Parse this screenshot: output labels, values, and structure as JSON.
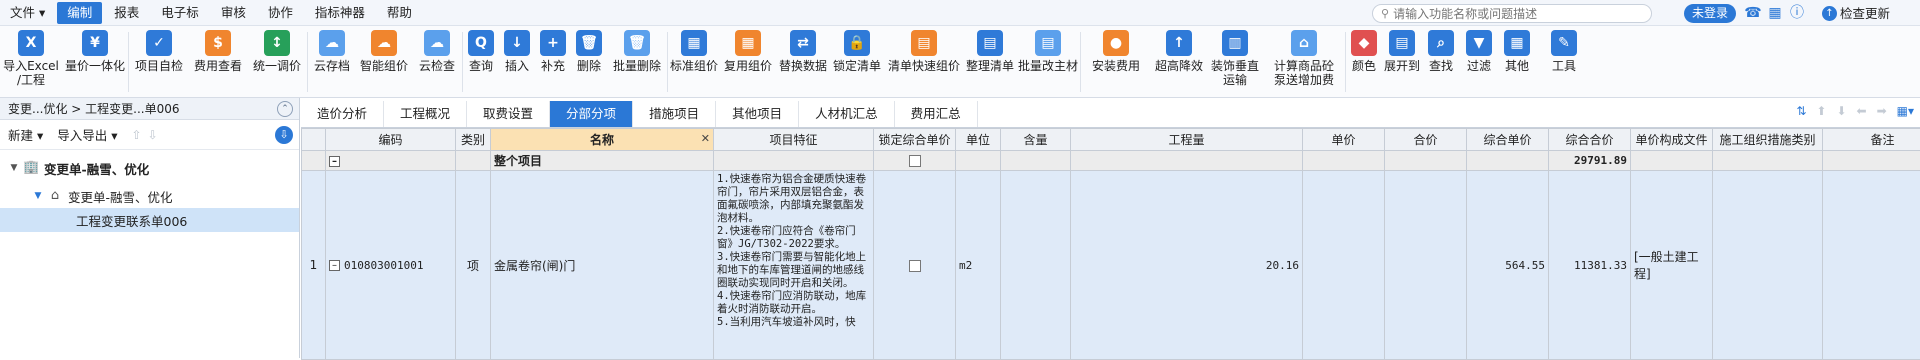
{
  "menu": {
    "file": "文件",
    "items": [
      "编制",
      "报表",
      "电子标",
      "审核",
      "协作",
      "指标神器",
      "帮助"
    ],
    "search_placeholder": "请输入功能名称或问题描述",
    "login": "未登录",
    "update": "检查更新"
  },
  "ribbon": [
    {
      "label": "导入Excel\n/工程",
      "icon": "excel-import-icon"
    },
    {
      "label": "量价一体化",
      "icon": "price-integration-icon"
    },
    {
      "label": "项目自检",
      "icon": "project-check-icon"
    },
    {
      "label": "费用查看",
      "icon": "cost-view-icon"
    },
    {
      "label": "统一调价",
      "icon": "adjust-price-icon"
    },
    {
      "label": "云存档",
      "icon": "cloud-archive-icon"
    },
    {
      "label": "智能组价",
      "icon": "smart-pricing-icon"
    },
    {
      "label": "云检查",
      "icon": "cloud-check-icon"
    },
    {
      "label": "查询",
      "icon": "query-icon"
    },
    {
      "label": "插入",
      "icon": "insert-icon"
    },
    {
      "label": "补充",
      "icon": "supplement-icon"
    },
    {
      "label": "删除",
      "icon": "delete-icon"
    },
    {
      "label": "批量删除",
      "icon": "batch-delete-icon"
    },
    {
      "label": "标准组价",
      "icon": "standard-pricing-icon"
    },
    {
      "label": "复用组价",
      "icon": "reuse-pricing-icon"
    },
    {
      "label": "替换数据",
      "icon": "replace-data-icon"
    },
    {
      "label": "锁定清单",
      "icon": "lock-list-icon"
    },
    {
      "label": "清单快速组价",
      "icon": "quick-pricing-icon"
    },
    {
      "label": "整理清单",
      "icon": "organize-list-icon"
    },
    {
      "label": "批量改主材",
      "icon": "batch-material-icon"
    },
    {
      "label": "安装费用",
      "icon": "install-cost-icon"
    },
    {
      "label": "超高降效",
      "icon": "high-efficiency-icon"
    },
    {
      "label": "装饰垂直\n运输",
      "icon": "vertical-transport-icon"
    },
    {
      "label": "计算商品砼\n泵送增加费",
      "icon": "concrete-pump-icon"
    },
    {
      "label": "颜色",
      "icon": "color-icon"
    },
    {
      "label": "展开到",
      "icon": "expand-to-icon"
    },
    {
      "label": "查找",
      "icon": "find-icon"
    },
    {
      "label": "过滤",
      "icon": "filter-icon"
    },
    {
      "label": "其他",
      "icon": "other-icon"
    },
    {
      "label": "工具",
      "icon": "tools-icon"
    }
  ],
  "left": {
    "breadcrumb": "变更...优化 > 工程变更...单006",
    "new_label": "新建",
    "import_export_label": "导入导出",
    "tree": [
      {
        "label": "变更单-融雪、优化",
        "level": 0
      },
      {
        "label": "变更单-融雪、优化",
        "level": 1
      },
      {
        "label": "工程变更联系单006",
        "level": 2
      }
    ]
  },
  "tabs": [
    "造价分析",
    "工程概况",
    "取费设置",
    "分部分项",
    "措施项目",
    "其他项目",
    "人材机汇总",
    "费用汇总"
  ],
  "active_tab": "分部分项",
  "table": {
    "headers": [
      "编码",
      "类别",
      "名称",
      "项目特征",
      "锁定综合单价",
      "单位",
      "含量",
      "工程量",
      "单价",
      "合价",
      "综合单价",
      "综合合价",
      "单价构成文件",
      "施工组织措施类别",
      "备注"
    ],
    "total_row": {
      "name": "整个项目",
      "total": "29791.89"
    },
    "item_row": {
      "index": "1",
      "code": "010803001001",
      "category": "项",
      "name": "金属卷帘(闸)门",
      "features": "1.快速卷帘为铝合金硬质快速卷帘门，帘片采用双层铝合金，表面氟碳喷涂，内部填充聚氨酯发泡材料。\n2.快速卷帘门应符合《卷帘门窗》JG/T302-2022要求。\n3.快速卷帘门需要与智能化地上和地下的车库管理道闸的地感线圈联动实现同时开启和关闭。\n4.快速卷帘门应消防联动，地库着火时消防联动开启。\n5.当利用汽车坡道补风时，快",
      "unit": "m2",
      "quantity": "20.16",
      "unit_price_total": "564.55",
      "total_price": "11381.33",
      "composition": "[一般土建工程]"
    }
  },
  "colors": {
    "accent": "#2b78d6",
    "selected_row": "#dfeaf8",
    "name_header": "#fbe1b3"
  }
}
